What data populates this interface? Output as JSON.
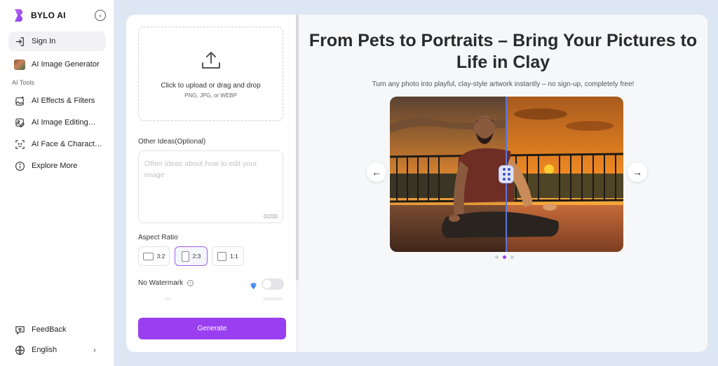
{
  "app": {
    "name": "BYLO AI",
    "brand_color": "#9a3ff0"
  },
  "sidebar": {
    "collapse_icon": "chevron-left-icon",
    "sign_in": {
      "label": "Sign In",
      "icon": "sign-in-icon"
    },
    "generator": {
      "label": "AI Image Generator",
      "icon": "thumbnail"
    },
    "section_label": "AI Tools",
    "items": [
      {
        "label": "AI Effects & Filters",
        "icon": "magic-image-icon"
      },
      {
        "label": "AI Image Editing…",
        "icon": "image-edit-icon"
      },
      {
        "label": "AI Face & Charact…",
        "icon": "face-scan-icon"
      },
      {
        "label": "Explore More",
        "icon": "info-circle-icon"
      }
    ],
    "feedback": {
      "label": "FeedBack",
      "icon": "chat-heart-icon"
    },
    "language": {
      "label": "English",
      "icon": "globe-icon"
    }
  },
  "form": {
    "upload": {
      "main_text": "Click to upload or drag and drop",
      "formats": "PNG, JPG, or WEBP",
      "icon": "upload-icon"
    },
    "ideas": {
      "label": "Other Ideas(Optional)",
      "placeholder": "Other ideas about how to edit your image",
      "counter": "0/200"
    },
    "aspect_ratio": {
      "label": "Aspect Ratio",
      "options": [
        "3:2",
        "2:3",
        "1:1"
      ],
      "selected": "2:3"
    },
    "watermark": {
      "label": "No Watermark",
      "enabled": false
    },
    "generate_label": "Generate"
  },
  "showcase": {
    "title": "From Pets to Portraits – Bring Your Pictures to Life in Clay",
    "subtitle": "Turn any photo into playful, clay-style artwork instantly – no sign-up, completely free!",
    "prev_arrow": "←",
    "next_arrow": "→",
    "slide_count": 3,
    "active_slide": 2
  }
}
